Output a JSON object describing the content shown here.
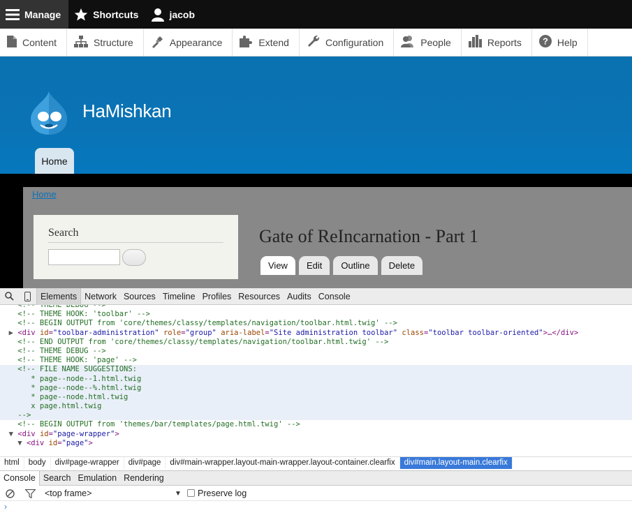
{
  "admin_bar": {
    "manage": "Manage",
    "shortcuts": "Shortcuts",
    "user": "jacob"
  },
  "tray": [
    {
      "label": "Content",
      "icon": "file-icon"
    },
    {
      "label": "Structure",
      "icon": "sitemap-icon"
    },
    {
      "label": "Appearance",
      "icon": "paintbrush-icon"
    },
    {
      "label": "Extend",
      "icon": "puzzle-icon"
    },
    {
      "label": "Configuration",
      "icon": "wrench-icon"
    },
    {
      "label": "People",
      "icon": "people-icon"
    },
    {
      "label": "Reports",
      "icon": "bar-chart-icon"
    },
    {
      "label": "Help",
      "icon": "help-icon"
    }
  ],
  "site": {
    "name": "HaMishkan",
    "home_tab": "Home",
    "breadcrumb": "Home"
  },
  "search_block": {
    "title": "Search",
    "input_value": ""
  },
  "node": {
    "title": "Gate of ReIncarnation - Part 1",
    "tabs": [
      "View",
      "Edit",
      "Outline",
      "Delete"
    ]
  },
  "devtools": {
    "tabs": [
      "Elements",
      "Network",
      "Sources",
      "Timeline",
      "Profiles",
      "Resources",
      "Audits",
      "Console"
    ],
    "code_lines": [
      {
        "t": "cm",
        "ind": "    ",
        "text": "<!-- THEME DEBUG -->",
        "partial": true
      },
      {
        "t": "cm",
        "ind": "    ",
        "text": "<!-- THEME HOOK: 'toolbar' -->"
      },
      {
        "t": "cm",
        "ind": "    ",
        "text": "<!-- BEGIN OUTPUT from 'core/themes/classy/templates/navigation/toolbar.html.twig' -->"
      },
      {
        "t": "el",
        "ind": "  ",
        "arrow": "▶",
        "open": "<div",
        "attrs": [
          [
            "id",
            "\"toolbar-administration\""
          ],
          [
            "role",
            "\"group\""
          ],
          [
            "aria-label",
            "\"Site administration toolbar\""
          ],
          [
            "class",
            "\"toolbar toolbar-oriented\""
          ]
        ],
        "close": ">…</div>"
      },
      {
        "t": "cm",
        "ind": "    ",
        "text": "<!-- END OUTPUT from 'core/themes/classy/templates/navigation/toolbar.html.twig' -->"
      },
      {
        "t": "cm",
        "ind": "    ",
        "text": "<!-- THEME DEBUG -->"
      },
      {
        "t": "cm",
        "ind": "    ",
        "text": "<!-- THEME HOOK: 'page' -->"
      },
      {
        "t": "cm",
        "ind": "    ",
        "text": "<!-- FILE NAME SUGGESTIONS:",
        "hl": true
      },
      {
        "t": "cm",
        "ind": "       ",
        "text": "* page--node--1.html.twig",
        "hl": true
      },
      {
        "t": "cm",
        "ind": "       ",
        "text": "* page--node--%.html.twig",
        "hl": true
      },
      {
        "t": "cm",
        "ind": "       ",
        "text": "* page--node.html.twig",
        "hl": true
      },
      {
        "t": "cm",
        "ind": "       ",
        "text": "x page.html.twig",
        "hl": true
      },
      {
        "t": "cm",
        "ind": "    ",
        "text": "-->",
        "hl": true
      },
      {
        "t": "cm",
        "ind": "    ",
        "text": "<!-- BEGIN OUTPUT from 'themes/bar/templates/page.html.twig' -->"
      },
      {
        "t": "el",
        "ind": "  ",
        "arrow": "▼",
        "open": "<div",
        "attrs": [
          [
            "id",
            "\"page-wrapper\""
          ]
        ],
        "close": ">"
      },
      {
        "t": "el",
        "ind": "    ",
        "arrow": "▼",
        "open": "<div",
        "attrs": [
          [
            "id",
            "\"page\""
          ]
        ],
        "close": ">"
      }
    ],
    "breadcrumbs": [
      "html",
      "body",
      "div#page-wrapper",
      "div#page",
      "div#main-wrapper.layout-main-wrapper.layout-container.clearfix",
      "div#main.layout-main.clearfix"
    ],
    "drawer_tabs": [
      "Console",
      "Search",
      "Emulation",
      "Rendering"
    ],
    "frame_select": "<top frame>",
    "preserve_log": "Preserve log",
    "prompt": "›"
  }
}
